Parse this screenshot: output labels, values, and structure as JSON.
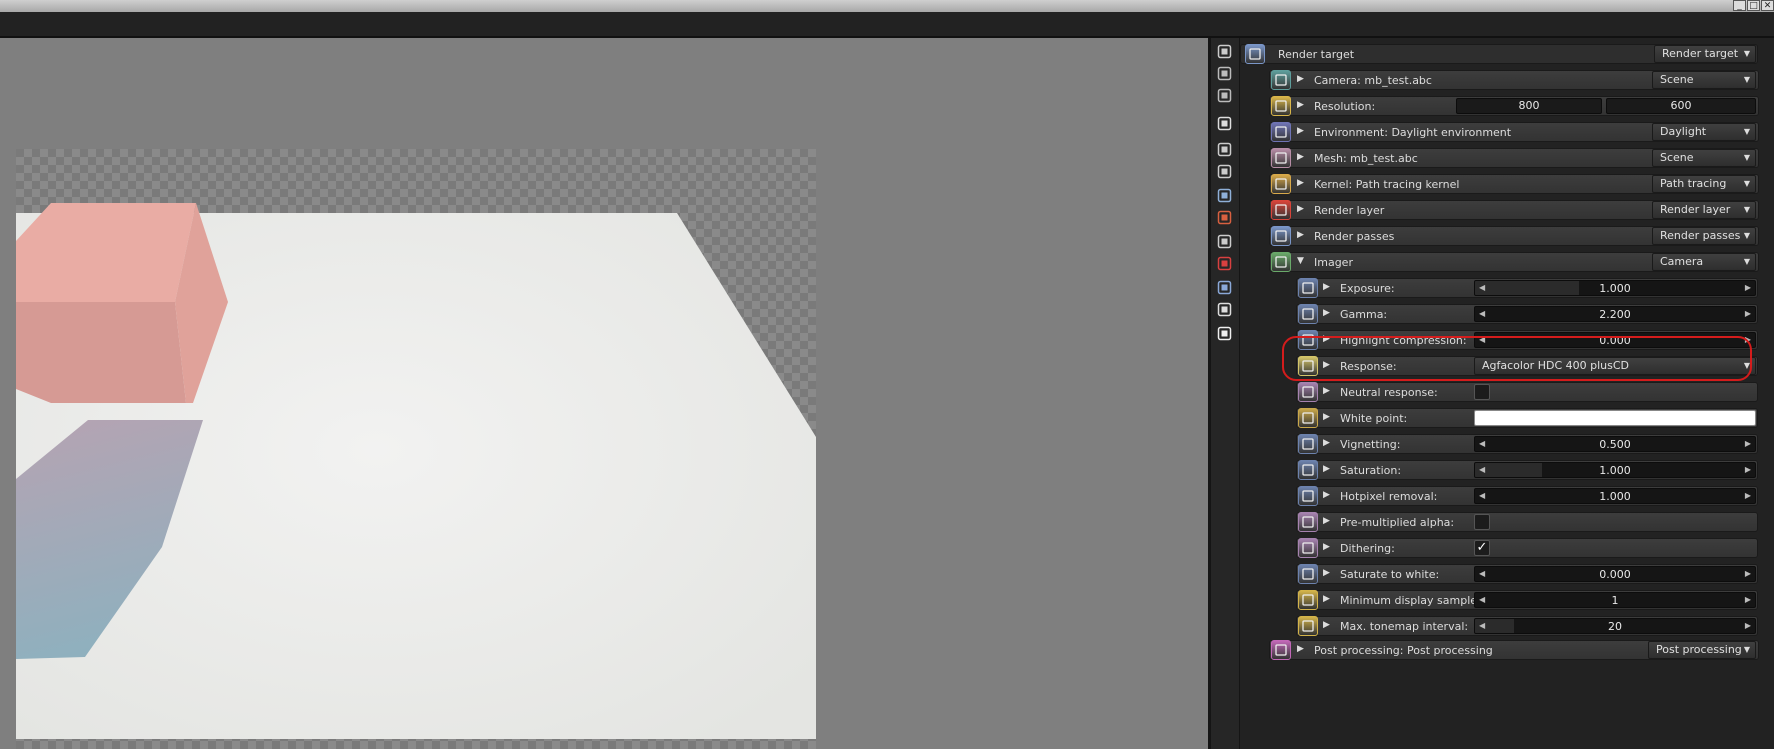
{
  "window": {
    "buttons": [
      "_",
      "□",
      "✕"
    ]
  },
  "viewport": {
    "canvas": "render preview"
  },
  "sidebar_icons": [
    "camera-settings-icon",
    "layers-icon",
    "list-icon",
    "image-icon",
    "kernel-icon",
    "resolution-icon",
    "environment-icon",
    "material-icon",
    "kernel-alt-icon",
    "render-layer-icon",
    "render-passes-icon",
    "imager-icon",
    "post-processing-icon"
  ],
  "panel": {
    "header": {
      "label": "Render target",
      "combo": "Render target"
    },
    "nodes": [
      {
        "label": "Camera: mb_test.abc",
        "combo": "Scene",
        "color": "#5e9e9c"
      },
      {
        "label": "Resolution:",
        "values": [
          "800",
          "600"
        ],
        "color": "#d9b64a"
      },
      {
        "label": "Environment: Daylight environment",
        "combo": "Daylight",
        "color": "#6f74b5"
      },
      {
        "label": "Mesh: mb_test.abc",
        "combo": "Scene",
        "color": "#b88ea7"
      },
      {
        "label": "Kernel: Path tracing kernel",
        "combo": "Path tracing",
        "color": "#d8a94a"
      },
      {
        "label": "Render layer",
        "combo": "Render layer",
        "color": "#d9443a"
      },
      {
        "label": "Render passes",
        "combo": "Render passes",
        "color": "#7a96c8"
      },
      {
        "label": "Imager",
        "combo": "Camera",
        "color": "#6aaa6a"
      }
    ],
    "imager_items": [
      {
        "label": "Exposure:",
        "type": "slider",
        "value": "1.000",
        "fill": 0.37,
        "color": "#6c82ad"
      },
      {
        "label": "Gamma:",
        "type": "slider",
        "value": "2.200",
        "fill": 0.0,
        "color": "#6c82ad"
      },
      {
        "label": "Highlight compression:",
        "type": "slider",
        "value": "0.000",
        "fill": 0.0,
        "color": "#6c82ad"
      },
      {
        "label": "Response:",
        "type": "combo",
        "value": "Agfacolor HDC 400 plusCD",
        "color": "#d4c56a"
      },
      {
        "label": "Neutral response:",
        "type": "check",
        "value": "",
        "color": "#a783b0"
      },
      {
        "label": "White point:",
        "type": "color",
        "value": "#ffffff",
        "color": "#caa84a"
      },
      {
        "label": "Vignetting:",
        "type": "slider",
        "value": "0.500",
        "fill": 0.0,
        "color": "#6c82ad"
      },
      {
        "label": "Saturation:",
        "type": "slider",
        "value": "1.000",
        "fill": 0.24,
        "color": "#6c82ad"
      },
      {
        "label": "Hotpixel removal:",
        "type": "slider",
        "value": "1.000",
        "fill": 0.0,
        "color": "#6c82ad"
      },
      {
        "label": "Pre-multiplied alpha:",
        "type": "check",
        "value": "",
        "color": "#a783b0"
      },
      {
        "label": "Dithering:",
        "type": "check",
        "value": "✓",
        "color": "#a783b0"
      },
      {
        "label": "Saturate to white:",
        "type": "slider",
        "value": "0.000",
        "fill": 0.0,
        "color": "#6c82ad"
      },
      {
        "label": "Minimum display samples:",
        "type": "slider",
        "value": "1",
        "fill": 0.0,
        "color": "#d4b44a"
      },
      {
        "label": "Max. tonemap interval:",
        "type": "slider",
        "value": "20",
        "fill": 0.14,
        "color": "#d4b44a"
      }
    ],
    "post": {
      "label": "Post processing: Post processing",
      "combo": "Post processing",
      "color": "#c268b8"
    }
  }
}
